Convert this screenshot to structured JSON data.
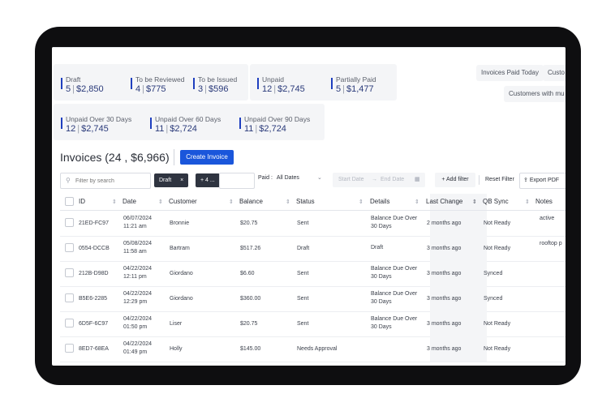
{
  "summary_cards": [
    {
      "label": "Draft",
      "count": "5",
      "amount": "$2,850"
    },
    {
      "label": "To be Reviewed",
      "count": "4",
      "amount": "$775"
    },
    {
      "label": "To be Issued",
      "count": "3",
      "amount": "$596"
    },
    {
      "label": "Unpaid",
      "count": "12",
      "amount": "$2,745"
    },
    {
      "label": "Partially Paid",
      "count": "5",
      "amount": "$1,477"
    },
    {
      "label": "Unpaid Over 30 Days",
      "count": "12",
      "amount": "$2,745"
    },
    {
      "label": "Unpaid Over 60 Days",
      "count": "11",
      "amount": "$2,724"
    },
    {
      "label": "Unpaid Over 90 Days",
      "count": "11",
      "amount": "$2,724"
    }
  ],
  "side_chips": {
    "invoices_paid_today": "Invoices Paid Today",
    "customers_truncated": "Custo",
    "customers_with": "Customers with mu"
  },
  "page_title": "Invoices (24 , $6,966)",
  "create_button": "Create Invoice",
  "toolbar": {
    "search_placeholder": "Filter by search",
    "draft_tag": "Draft",
    "draft_close": "×",
    "more_tag": "+ 4 ...",
    "paid_label": "Paid :",
    "paid_value": "All Dates",
    "start_date": "Start Date",
    "arrow": "→",
    "end_date": "End Date",
    "add_filter": "+ Add filter",
    "reset_filter": "Reset Filter",
    "export_pdf": "Export PDF"
  },
  "columns": [
    "ID",
    "Date",
    "Customer",
    "Balance",
    "Status",
    "Details",
    "Last Change",
    "QB Sync",
    "Notes"
  ],
  "rows": [
    {
      "id": "21ED-FC97",
      "date": "06/07/2024",
      "time": "11:21 am",
      "customer": "Bronnie",
      "balance": "$20.75",
      "status": "Sent",
      "details1": "Balance Due Over",
      "details2": "30 Days",
      "last_change": "2 months ago",
      "qb_sync": "Not Ready",
      "notes": "active"
    },
    {
      "id": "0554-DCCB",
      "date": "05/08/2024",
      "time": "11:58 am",
      "customer": "Bartram",
      "balance": "$517.26",
      "status": "Draft",
      "details1": "Draft",
      "details2": "",
      "last_change": "3 months ago",
      "qb_sync": "Not Ready",
      "notes": "rooftop p"
    },
    {
      "id": "212B-D98D",
      "date": "04/22/2024",
      "time": "12:11 pm",
      "customer": "Giordano",
      "balance": "$6.60",
      "status": "Sent",
      "details1": "Balance Due Over",
      "details2": "30 Days",
      "last_change": "3 months ago",
      "qb_sync": "Synced",
      "notes": ""
    },
    {
      "id": "B5E6-2285",
      "date": "04/22/2024",
      "time": "12:29 pm",
      "customer": "Giordano",
      "balance": "$360.00",
      "status": "Sent",
      "details1": "Balance Due Over",
      "details2": "30 Days",
      "last_change": "3 months ago",
      "qb_sync": "Synced",
      "notes": ""
    },
    {
      "id": "6D5F-6C97",
      "date": "04/22/2024",
      "time": "01:50 pm",
      "customer": "Liser",
      "balance": "$20.75",
      "status": "Sent",
      "details1": "Balance Due Over",
      "details2": "30 Days",
      "last_change": "3 months ago",
      "qb_sync": "Not Ready",
      "notes": ""
    },
    {
      "id": "8ED7-68EA",
      "date": "04/22/2024",
      "time": "01:49 pm",
      "customer": "Holly",
      "balance": "$145.00",
      "status": "Needs Approval",
      "details1": "",
      "details2": "",
      "last_change": "3 months ago",
      "qb_sync": "Not Ready",
      "notes": ""
    }
  ]
}
